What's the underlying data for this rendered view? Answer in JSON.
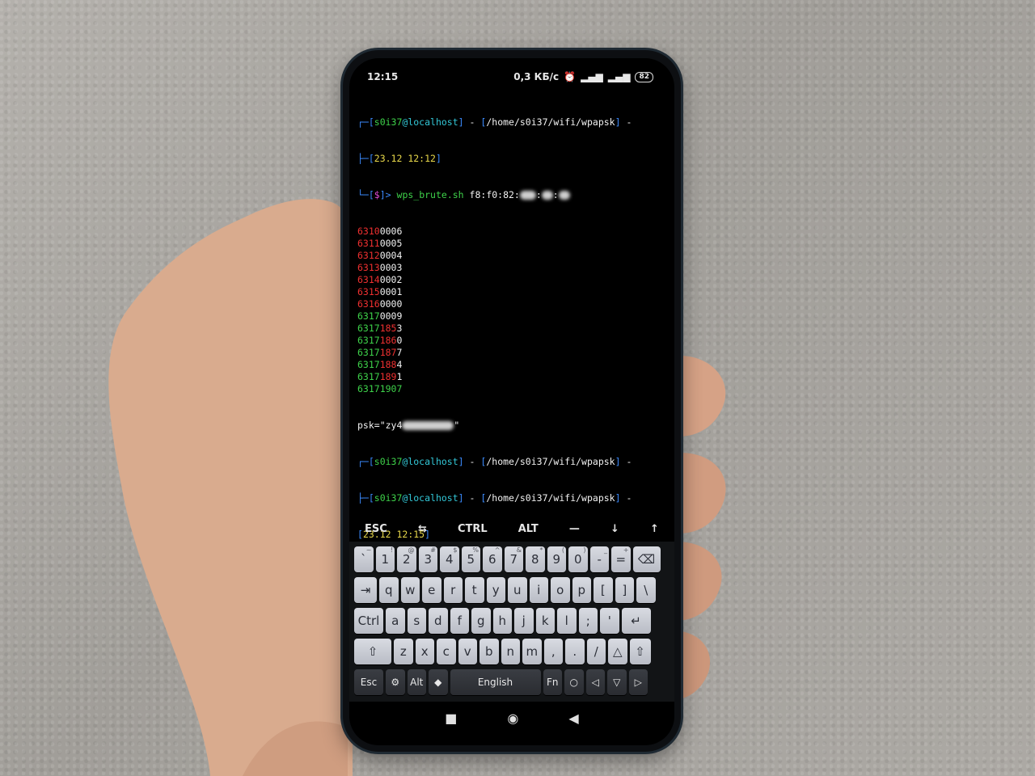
{
  "status_bar": {
    "time": "12:15",
    "net_speed": "0,3 КБ/с",
    "battery": "82",
    "icons": [
      "alarm-icon",
      "signal-icon",
      "signal-4g-icon",
      "battery-icon"
    ]
  },
  "terminal": {
    "prompt1": {
      "user": "s0i37",
      "host": "@localhost",
      "path": "/home/s0i37/wifi/wpapsk",
      "date": "23.12 12:12",
      "symbol": "$",
      "command": "wps_brute.sh",
      "arg": "f8:f0:82:"
    },
    "pins": [
      {
        "red": "6310",
        "white": "0006"
      },
      {
        "red": "6311",
        "white": "0005"
      },
      {
        "red": "6312",
        "white": "0004"
      },
      {
        "red": "6313",
        "white": "0003"
      },
      {
        "red": "6314",
        "white": "0002"
      },
      {
        "red": "6315",
        "white": "0001"
      },
      {
        "red": "6316",
        "white": "0000"
      },
      {
        "green": "6317",
        "white": "0009"
      },
      {
        "green": "6317",
        "red": "185",
        "white": "3"
      },
      {
        "green": "6317",
        "red": "186",
        "white": "0"
      },
      {
        "green": "6317",
        "red": "187",
        "white": "7"
      },
      {
        "green": "6317",
        "red": "188",
        "white": "4"
      },
      {
        "green": "6317",
        "red": "189",
        "white": "1"
      },
      {
        "green": "63171907"
      }
    ],
    "psk_prefix": "psk=\"zy4",
    "psk_suffix": "\"",
    "prompt2": {
      "user": "s0i37",
      "host": "@localhost",
      "path": "/home/s0i37/wifi/wpapsk"
    },
    "prompt3": {
      "user": "s0i37",
      "host": "@localhost",
      "path": "/home/s0i37/wifi/wpapsk",
      "date": "23.12 12:15",
      "symbol": "$"
    }
  },
  "extra_keys": [
    "ESC",
    "⇆",
    "CTRL",
    "ALT",
    "—",
    "↓",
    "↑"
  ],
  "keyboard": {
    "row1": [
      [
        "`",
        "~"
      ],
      [
        "1",
        "!"
      ],
      [
        "2",
        "@"
      ],
      [
        "3",
        "#"
      ],
      [
        "4",
        "$"
      ],
      [
        "5",
        "%"
      ],
      [
        "6",
        "^"
      ],
      [
        "7",
        "&"
      ],
      [
        "8",
        "*"
      ],
      [
        "9",
        "("
      ],
      [
        "0",
        ")"
      ],
      [
        "-",
        "_"
      ],
      [
        "=",
        "+"
      ]
    ],
    "row2": [
      "q",
      "w",
      "e",
      "r",
      "t",
      "y",
      "u",
      "i",
      "o",
      "p",
      "[",
      "]",
      "\\"
    ],
    "row3": [
      "a",
      "s",
      "d",
      "f",
      "g",
      "h",
      "j",
      "k",
      "l",
      ";",
      "'"
    ],
    "row4": [
      "z",
      "x",
      "c",
      "v",
      "b",
      "n",
      "m",
      ",",
      ".",
      "/"
    ],
    "ctrl_label": "Ctrl",
    "esc_label": "Esc",
    "alt_label": "Alt",
    "fn_label": "Fn",
    "space_label": "English"
  }
}
